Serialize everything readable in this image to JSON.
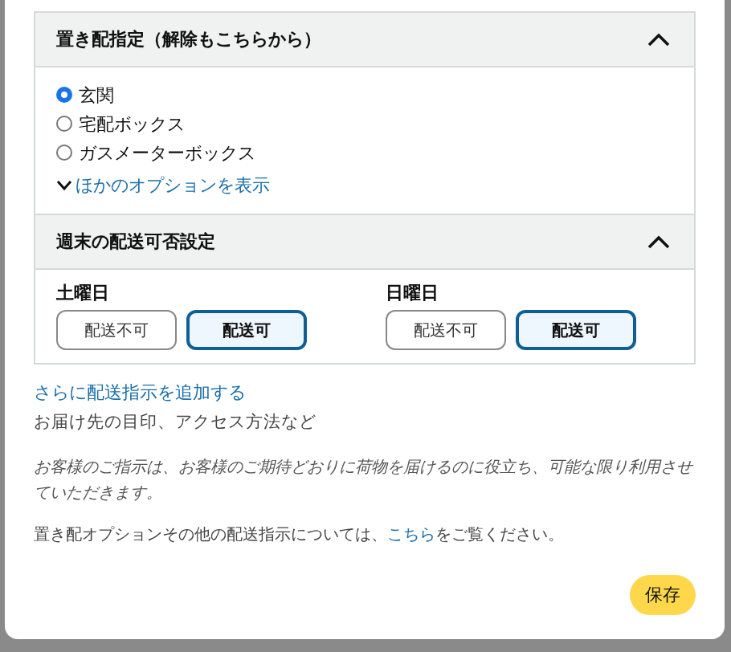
{
  "placement": {
    "title": "置き配指定（解除もこちらから）",
    "expanded": true,
    "options": [
      {
        "label": "玄関",
        "selected": true
      },
      {
        "label": "宅配ボックス",
        "selected": false
      },
      {
        "label": "ガスメーターボックス",
        "selected": false
      }
    ],
    "more_link": "ほかのオプションを表示"
  },
  "weekend": {
    "title": "週末の配送可否設定",
    "expanded": true,
    "days": [
      {
        "label": "土曜日",
        "options": [
          {
            "label": "配送不可",
            "selected": false
          },
          {
            "label": "配送可",
            "selected": true
          }
        ]
      },
      {
        "label": "日曜日",
        "options": [
          {
            "label": "配送不可",
            "selected": false
          },
          {
            "label": "配送可",
            "selected": true
          }
        ]
      }
    ]
  },
  "add_instructions_link": "さらに配送指示を追加する",
  "add_instructions_hint": "お届け先の目印、アクセス方法など",
  "note": "お客様のご指示は、お客様のご期待どおりに荷物を届けるのに役立ち、可能な限り利用させていただきます。",
  "info": {
    "before": "置き配オプションその他の配送指示については、",
    "link": "こちら",
    "after": "をご覧ください。"
  },
  "save_button": "保存"
}
